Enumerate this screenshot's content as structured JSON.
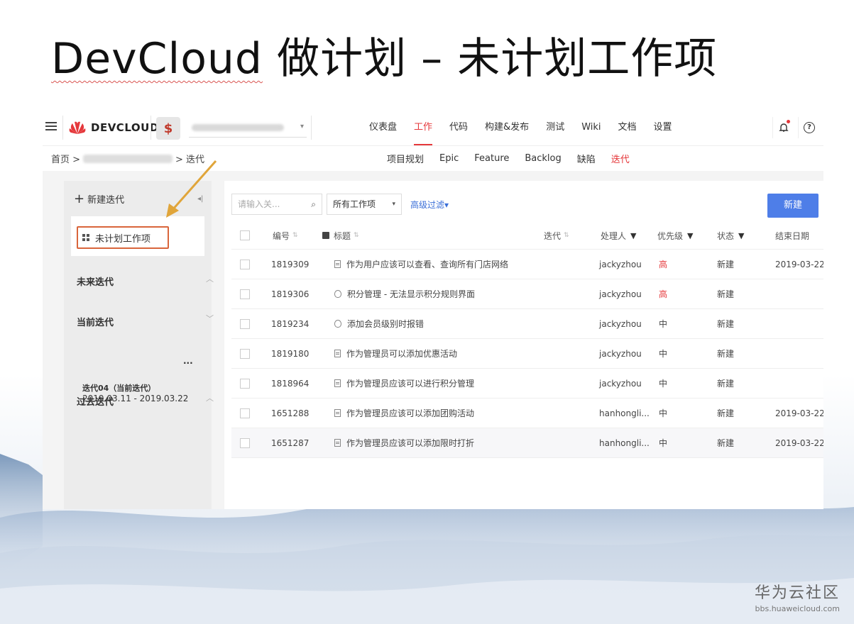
{
  "slide": {
    "title_brand": "DevCloud",
    "title_rest": " 做计划 – 未计划工作项",
    "watermark_title": "华为云社区",
    "watermark_url": "bbs.huaweicloud.com"
  },
  "app": {
    "logo_text": "DEVCLOUD",
    "project_icon": "$",
    "main_nav": [
      {
        "label": "仪表盘",
        "active": false
      },
      {
        "label": "工作",
        "active": true
      },
      {
        "label": "代码",
        "active": false
      },
      {
        "label": "构建&发布",
        "active": false
      },
      {
        "label": "测试",
        "active": false
      },
      {
        "label": "Wiki",
        "active": false
      },
      {
        "label": "文档",
        "active": false
      },
      {
        "label": "设置",
        "active": false
      }
    ],
    "breadcrumb": {
      "home": "首页 >",
      "current": "> 迭代"
    },
    "sub_nav": [
      {
        "label": "项目规划",
        "active": false
      },
      {
        "label": "Epic",
        "active": false
      },
      {
        "label": "Feature",
        "active": false
      },
      {
        "label": "Backlog",
        "active": false
      },
      {
        "label": "缺陷",
        "active": false
      },
      {
        "label": "迭代",
        "active": true
      }
    ],
    "sidebar": {
      "new_iteration": "新建迭代",
      "unplanned": "未计划工作项",
      "future": "未来迭代",
      "current": "当前迭代",
      "current_iteration_name": "迭代04（当前迭代）",
      "current_iteration_dates": "2019.03.11 - 2019.03.22",
      "more": "···",
      "past": "过去迭代"
    },
    "toolbar": {
      "search_placeholder": "请输入关...",
      "type_select": "所有工作项",
      "advanced_filter": "高级过滤▾",
      "new_button": "新建"
    },
    "table": {
      "headers": {
        "id": "编号",
        "title": "标题",
        "iteration": "迭代",
        "assignee": "处理人",
        "priority": "优先级",
        "status": "状态",
        "end_date": "结束日期"
      },
      "rows": [
        {
          "id": "1819309",
          "icon": "doc-icon",
          "title": "作为用户应该可以查看、查询所有门店网络",
          "assignee": "jackyzhou",
          "priority": "高",
          "status": "新建",
          "end_date": "2019-03-22"
        },
        {
          "id": "1819306",
          "icon": "bug-icon",
          "title": "积分管理 - 无法显示积分规则界面",
          "assignee": "jackyzhou",
          "priority": "高",
          "status": "新建",
          "end_date": ""
        },
        {
          "id": "1819234",
          "icon": "bug-icon",
          "title": "添加会员级别时报错",
          "assignee": "jackyzhou",
          "priority": "中",
          "status": "新建",
          "end_date": ""
        },
        {
          "id": "1819180",
          "icon": "doc-icon",
          "title": "作为管理员可以添加优惠活动",
          "assignee": "jackyzhou",
          "priority": "中",
          "status": "新建",
          "end_date": ""
        },
        {
          "id": "1818964",
          "icon": "doc-icon",
          "title": "作为管理员应该可以进行积分管理",
          "assignee": "jackyzhou",
          "priority": "中",
          "status": "新建",
          "end_date": ""
        },
        {
          "id": "1651288",
          "icon": "doc-icon",
          "title": "作为管理员应该可以添加团购活动",
          "assignee": "hanhongli...",
          "priority": "中",
          "status": "新建",
          "end_date": "2019-03-22"
        },
        {
          "id": "1651287",
          "icon": "doc-icon",
          "title": "作为管理员应该可以添加限时打折",
          "assignee": "hanhongli...",
          "priority": "中",
          "status": "新建",
          "end_date": "2019-03-22"
        }
      ]
    }
  },
  "colors": {
    "accent_red": "#e5383b",
    "primary_blue": "#4e7ee8",
    "highlight_orange": "#d9653b"
  }
}
